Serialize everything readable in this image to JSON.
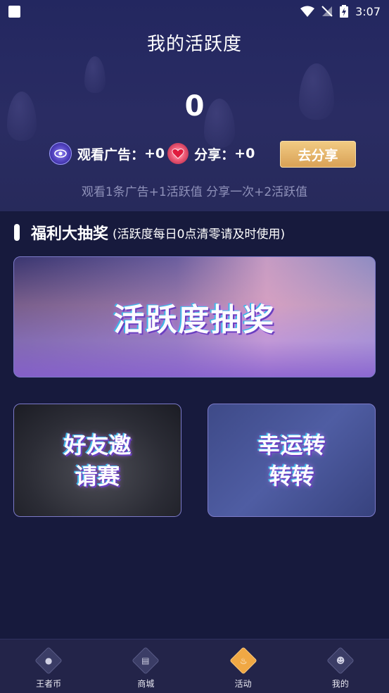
{
  "status_bar": {
    "time": "3:07"
  },
  "page": {
    "title": "我的活跃度"
  },
  "activity": {
    "score": "0",
    "ad_label": "观看广告：",
    "ad_value": "+0",
    "share_label": "分享：",
    "share_value": "+0",
    "share_button": "去分享",
    "hint": "观看1条广告+1活跃值  分享一次+2活跃值"
  },
  "section": {
    "title": "福利大抽奖",
    "subtitle": "(活跃度每日0点清零请及时使用)"
  },
  "cards": {
    "lottery": "活跃度抽奖",
    "friend_line1": "好友邀",
    "friend_line2": "请赛",
    "lucky_line1": "幸运转",
    "lucky_line2": "转转"
  },
  "nav": [
    {
      "label": "王者币",
      "icon": "coin-icon"
    },
    {
      "label": "商城",
      "icon": "shop-icon"
    },
    {
      "label": "活动",
      "icon": "fire-icon"
    },
    {
      "label": "我的",
      "icon": "user-icon"
    }
  ],
  "colors": {
    "background": "#171a3d",
    "accent": "#f0a844",
    "share_button": "#e0b068"
  }
}
